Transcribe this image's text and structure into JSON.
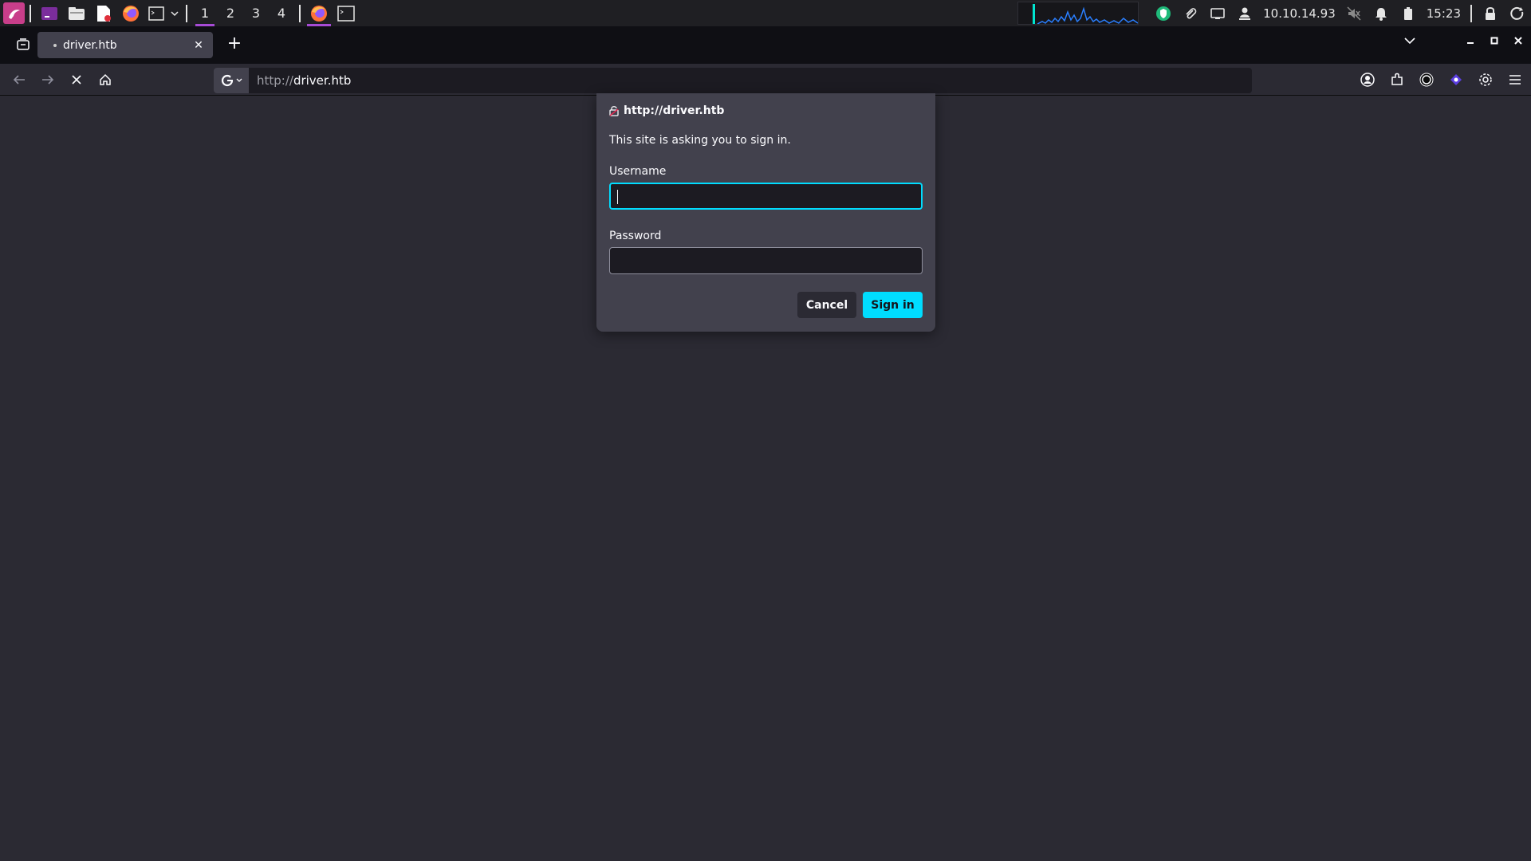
{
  "panel": {
    "workspaces": [
      "1",
      "2",
      "3",
      "4"
    ],
    "active_workspace": "1",
    "ip_address": "10.10.14.93",
    "clock": "15:23",
    "icons": {
      "menu": "kali-dragon-icon",
      "terminal_app": "terminal-icon",
      "files_app": "folder-icon",
      "editor_app": "text-editor-icon",
      "browser_app": "firefox-icon",
      "vpn": "vpn-shield-icon",
      "clip": "paperclip-icon",
      "display": "monitor-icon",
      "network": "network-user-icon",
      "volume": "volume-muted-icon",
      "notifications": "bell-icon",
      "battery": "battery-icon",
      "lock": "lock-icon",
      "power": "power-icon"
    }
  },
  "browser": {
    "tab_title": "driver.htb",
    "url_scheme": "http://",
    "url_host": "driver.htb",
    "accent": "#00ddff"
  },
  "dialog": {
    "origin": "http://driver.htb",
    "message": "This site is asking you to sign in.",
    "username_label": "Username",
    "username_value": "",
    "password_label": "Password",
    "password_value": "",
    "cancel_label": "Cancel",
    "signin_label": "Sign in"
  }
}
